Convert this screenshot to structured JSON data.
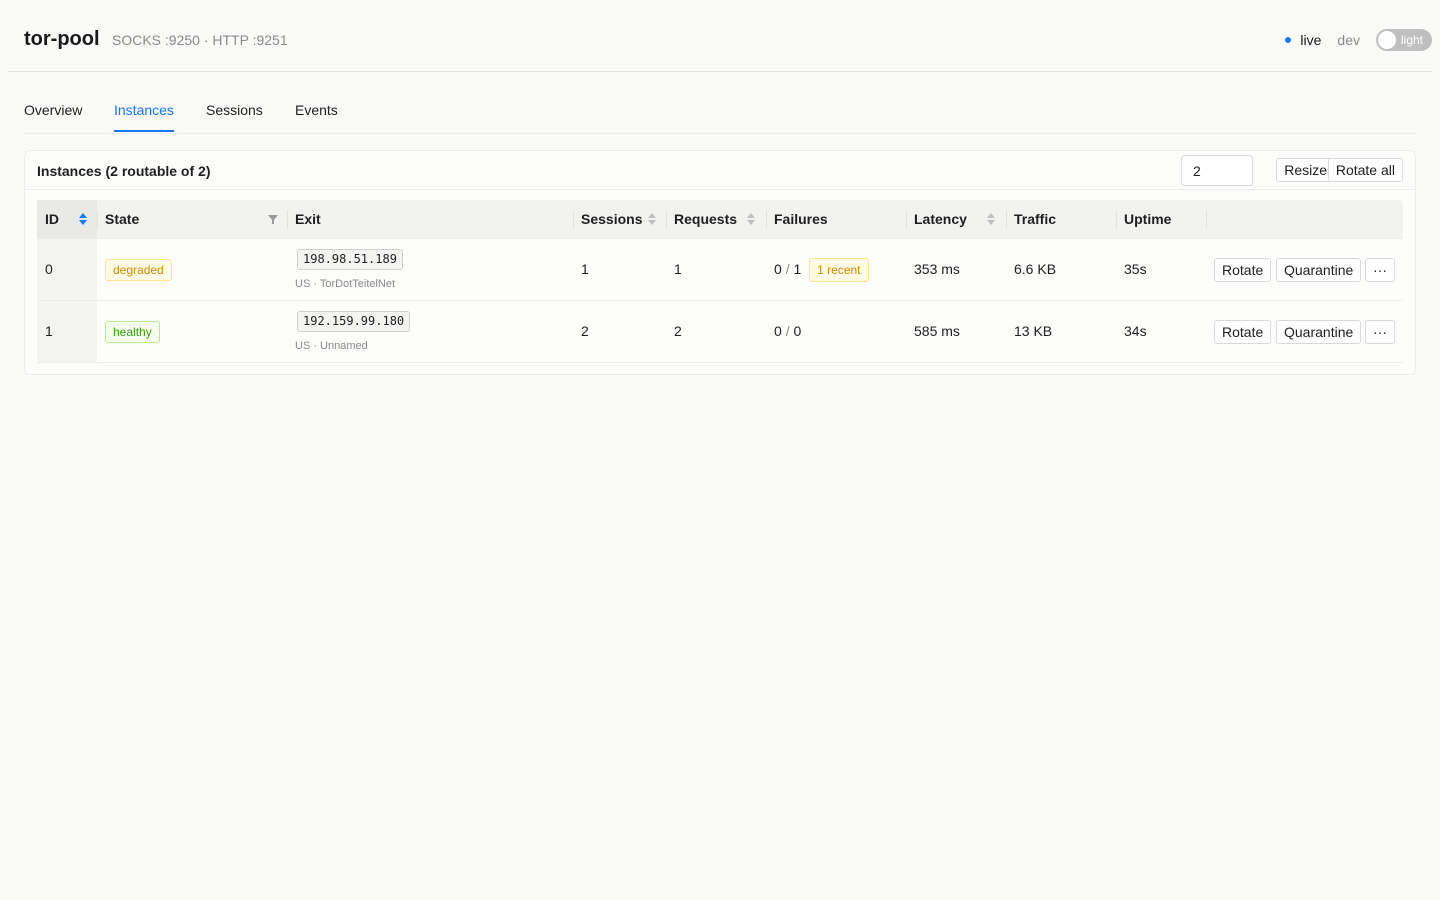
{
  "header": {
    "brand": "tor-pool",
    "ports": "SOCKS :9250 · HTTP :9251",
    "live_label": "live",
    "env_label": "dev",
    "theme_toggle_label": "light"
  },
  "tabs": [
    {
      "label": "Overview",
      "active": false
    },
    {
      "label": "Instances",
      "active": true
    },
    {
      "label": "Sessions",
      "active": false
    },
    {
      "label": "Events",
      "active": false
    }
  ],
  "instances": {
    "title": "Instances (2 routable of 2)",
    "size_value": "2",
    "resize_label": "Resize",
    "rotate_all_label": "Rotate all",
    "columns": [
      "ID",
      "State",
      "Exit",
      "Sessions",
      "Requests",
      "Failures",
      "Latency",
      "Traffic",
      "Uptime"
    ],
    "rows": [
      {
        "id": "0",
        "state": "degraded",
        "exit_ip": "198.98.51.189",
        "exit_meta": "US · TorDotTeitelNet",
        "sessions": "1",
        "requests": "1",
        "failures_left": "0",
        "failures_right": "1",
        "failures_recent": "1 recent",
        "latency": "353 ms",
        "traffic": "6.6 KB",
        "uptime": "35s"
      },
      {
        "id": "1",
        "state": "healthy",
        "exit_ip": "192.159.99.180",
        "exit_meta": "US · Unnamed",
        "sessions": "2",
        "requests": "2",
        "failures_left": "0",
        "failures_right": "0",
        "failures_recent": "",
        "latency": "585 ms",
        "traffic": "13 KB",
        "uptime": "34s"
      }
    ],
    "actions": {
      "rotate": "Rotate",
      "quarantine": "Quarantine",
      "more": "···"
    }
  },
  "colors": {
    "accent": "#1677ff",
    "degraded": "#d48806",
    "healthy": "#389e0d"
  }
}
